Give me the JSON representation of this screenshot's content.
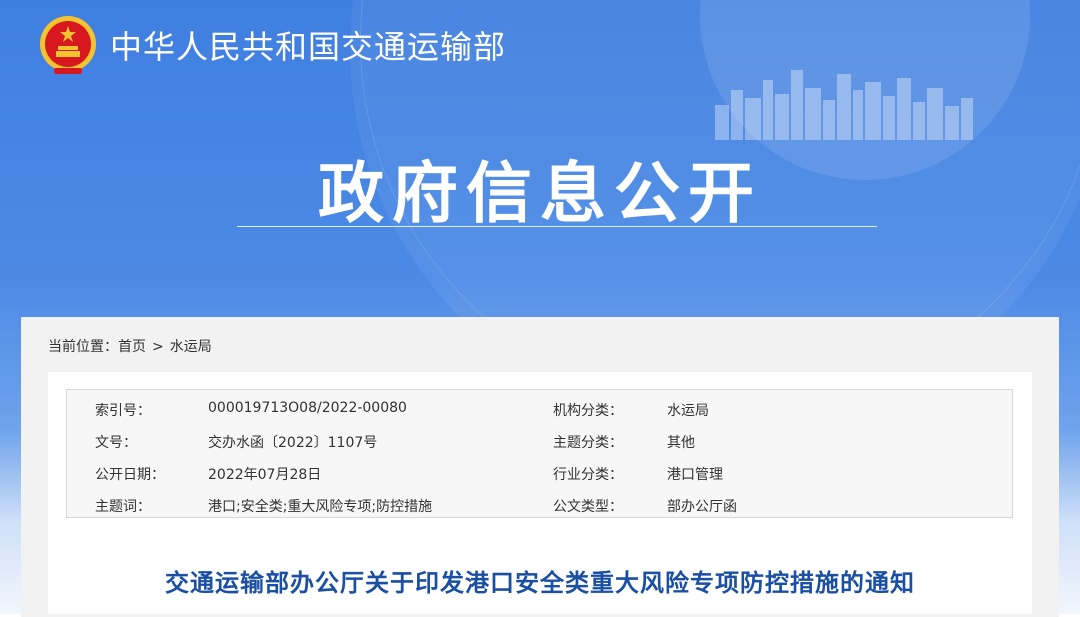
{
  "header": {
    "ministry_name": "中华人民共和国交通运输部",
    "hero_title": "政府信息公开"
  },
  "breadcrumb": {
    "prefix": "当前位置：",
    "items": [
      "首页",
      "水运局"
    ],
    "separator": ">"
  },
  "metadata": {
    "rows": [
      {
        "label1": "索引号：",
        "value1": "000019713O08/2022-00080",
        "label2": "机构分类：",
        "value2": "水运局"
      },
      {
        "label1": "文号：",
        "value1": "交办水函〔2022〕1107号",
        "label2": "主题分类：",
        "value2": "其他"
      },
      {
        "label1": "公开日期：",
        "value1": "2022年07月28日",
        "label2": "行业分类：",
        "value2": "港口管理"
      },
      {
        "label1": "主题词：",
        "value1": "港口;安全类;重大风险专项;防控措施",
        "label2": "公文类型：",
        "value2": "部办公厅函"
      }
    ]
  },
  "document": {
    "title": "交通运输部办公厅关于印发港口安全类重大风险专项防控措施的通知"
  },
  "colors": {
    "banner_blue": "#3f7fe0",
    "title_blue": "#1a4fa3",
    "emblem_red": "#d7191f",
    "emblem_gold": "#f4c430"
  },
  "icons": {
    "emblem": "national-emblem-icon",
    "skyline": "city-skyline-illustration"
  }
}
